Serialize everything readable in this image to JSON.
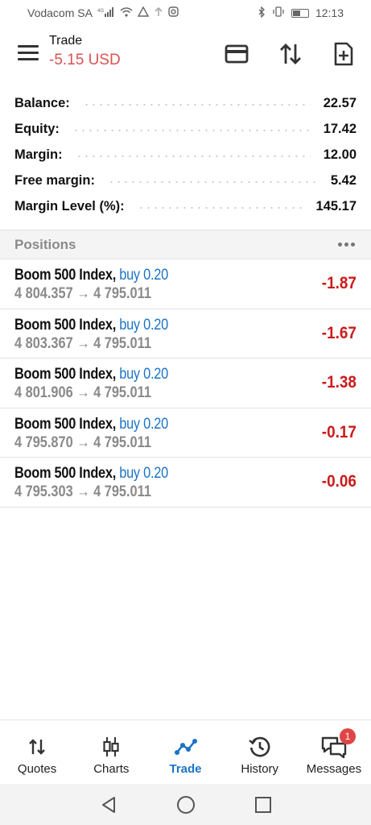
{
  "status_bar": {
    "carrier": "Vodacom SA",
    "network": "4G",
    "time": "12:13"
  },
  "header": {
    "title": "Trade",
    "profit": "-5.15 USD",
    "profit_color": "#d9534f"
  },
  "summary": [
    {
      "label": "Balance:",
      "value": "22.57"
    },
    {
      "label": "Equity:",
      "value": "17.42"
    },
    {
      "label": "Margin:",
      "value": "12.00"
    },
    {
      "label": "Free margin:",
      "value": "5.42"
    },
    {
      "label": "Margin Level (%):",
      "value": "145.17"
    }
  ],
  "positions_header": {
    "label": "Positions"
  },
  "positions": [
    {
      "symbol": "Boom 500 Index,",
      "type": "buy 0.20",
      "prices": "4 804.357 → 4 795.011",
      "profit": "-1.87"
    },
    {
      "symbol": "Boom 500 Index,",
      "type": "buy 0.20",
      "prices": "4 803.367 → 4 795.011",
      "profit": "-1.67"
    },
    {
      "symbol": "Boom 500 Index,",
      "type": "buy 0.20",
      "prices": "4 801.906 → 4 795.011",
      "profit": "-1.38"
    },
    {
      "symbol": "Boom 500 Index,",
      "type": "buy 0.20",
      "prices": "4 795.870 → 4 795.011",
      "profit": "-0.17"
    },
    {
      "symbol": "Boom 500 Index,",
      "type": "buy 0.20",
      "prices": "4 795.303 → 4 795.011",
      "profit": "-0.06"
    }
  ],
  "nav": {
    "items": [
      {
        "label": "Quotes",
        "icon": "quotes-icon"
      },
      {
        "label": "Charts",
        "icon": "charts-icon"
      },
      {
        "label": "Trade",
        "icon": "trade-icon",
        "active": true
      },
      {
        "label": "History",
        "icon": "history-icon"
      },
      {
        "label": "Messages",
        "icon": "messages-icon",
        "badge": "1"
      }
    ]
  },
  "colors": {
    "accent": "#1a73c8",
    "loss": "#cc1a1a",
    "badge": "#e04545"
  }
}
